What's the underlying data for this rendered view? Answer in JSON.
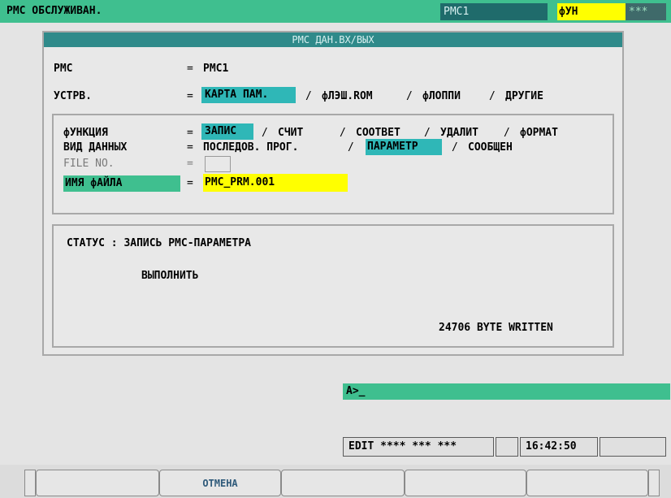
{
  "top_bar": {
    "title": "PMC ОБСЛУЖИВАН.",
    "pmc": "PMC1",
    "function": "фУН",
    "stars": "***"
  },
  "panel": {
    "title": "PMC ДАН.ВХ/ВЫХ",
    "pmc_label": "PMC",
    "pmc_value": "PMC1",
    "device_label": "УСТРВ.",
    "device_options": [
      "КАРТА ПАМ.",
      "фЛЭШ.ROM",
      "фЛОППИ",
      "ДРУГИЕ"
    ],
    "function_label": "фУНКЦИЯ",
    "function_options": [
      "ЗАПИС",
      "СЧИТ",
      "СООТВЕТ",
      "УДАЛИТ",
      "фОРМАТ"
    ],
    "datatype_label": "ВИД ДАННЫХ",
    "datatype_options": [
      "ПОСЛЕДОВ. ПРОГ.",
      "ПАРАМЕТР",
      "СООБЩЕН"
    ],
    "fileno_label": "FILE NO.",
    "filename_label": "ИМЯ фАЙЛА",
    "filename_value": "PMC_PRM.001",
    "equals": "=",
    "slash": "/",
    "status_line": "СТАТУС : ЗАПИСЬ PMC-ПАРАМЕТРА",
    "execute": "ВЫПОЛНИТЬ",
    "bytes_written": "24706 BYTE WRITTEN"
  },
  "input_prompt": "A>_",
  "status_row": {
    "mode": "EDIT **** *** ***",
    "time": "16:42:50"
  },
  "softkeys": [
    "",
    "ОТМЕНА",
    "",
    "",
    "",
    ""
  ],
  "colors": {
    "green": "#3fbf8f",
    "cyan": "#2fb7b7",
    "yellow": "#ffff00",
    "title_bar": "#2f8a8a"
  }
}
